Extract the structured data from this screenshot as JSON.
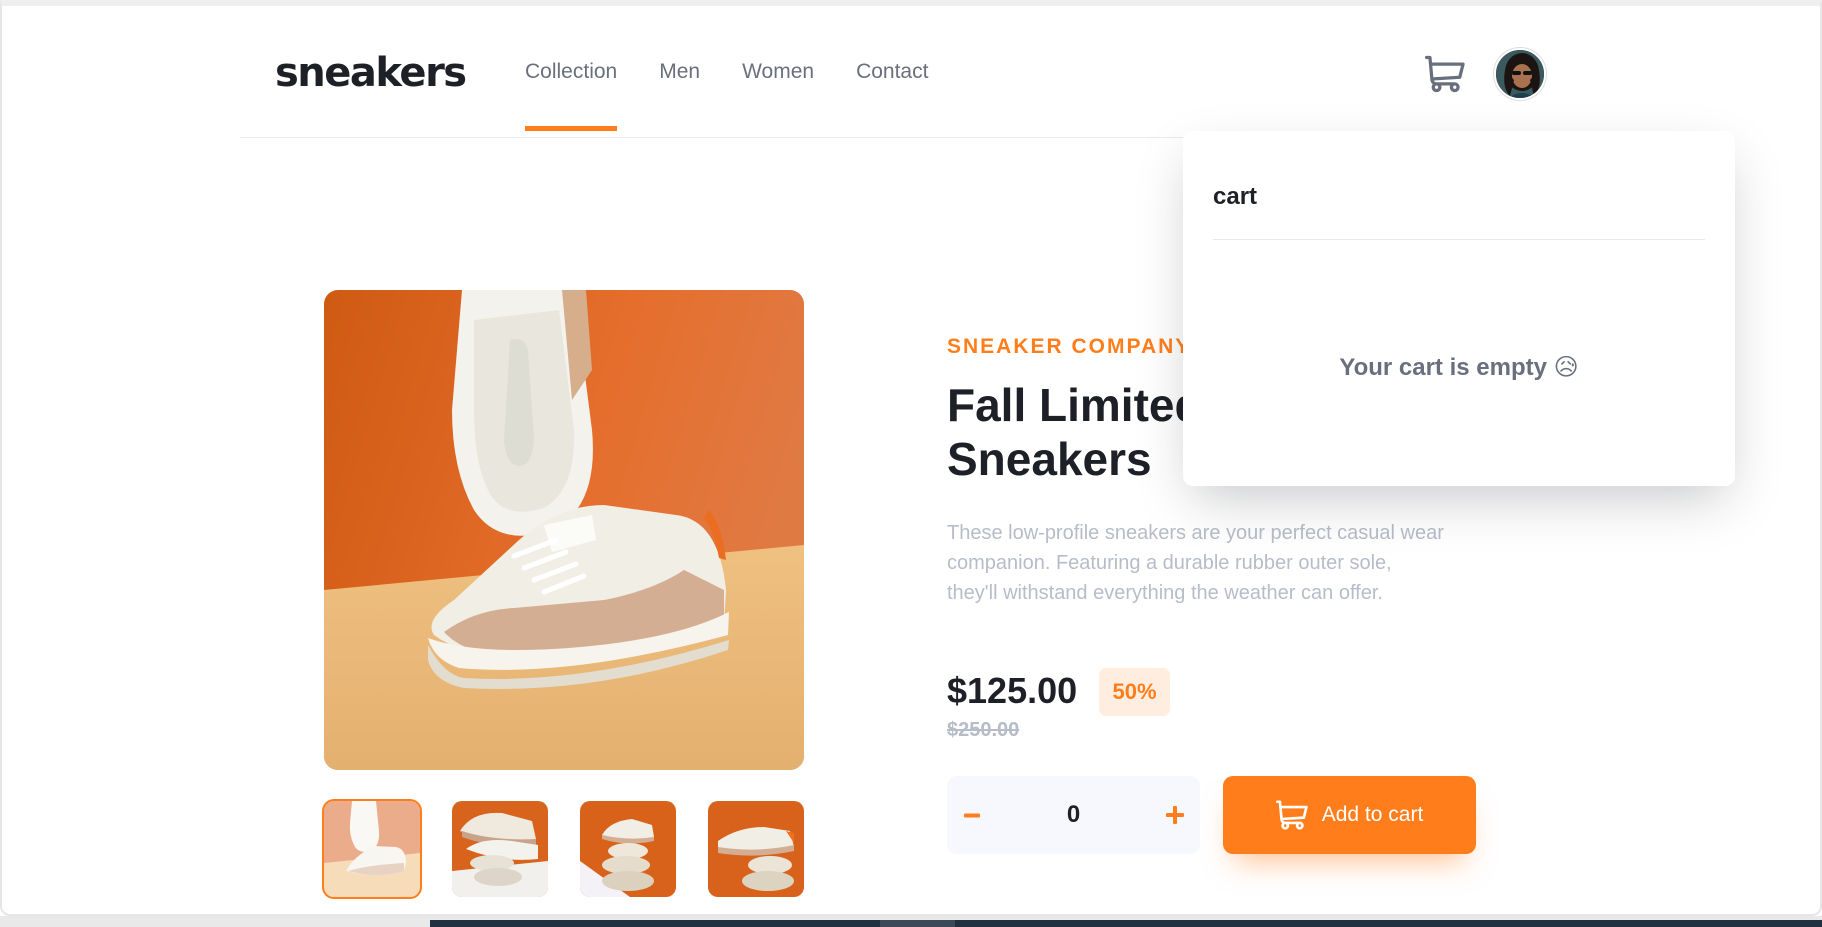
{
  "brand": {
    "logo": "sneakers"
  },
  "nav": {
    "items": [
      {
        "label": "Collection",
        "active": true
      },
      {
        "label": "Men",
        "active": false
      },
      {
        "label": "Women",
        "active": false
      },
      {
        "label": "Contact",
        "active": false
      }
    ]
  },
  "cart": {
    "title": "cart",
    "empty_message": "Your cart is empty 😥"
  },
  "product": {
    "company": "SNEAKER COMPANY",
    "title_line1": "Fall Limited Edition",
    "title_line2": "Sneakers",
    "description": "These low-profile sneakers are your perfect casual wear companion. Featuring a durable rubber outer sole, they'll withstand everything the weather can offer.",
    "price": "$125.00",
    "discount": "50%",
    "old_price": "$250.00"
  },
  "quantity": {
    "value": "0"
  },
  "actions": {
    "add_to_cart": "Add to cart"
  },
  "colors": {
    "accent": "#ff7e1b",
    "dark": "#1d2026",
    "muted": "#69707d",
    "light_muted": "#b6bcc8",
    "pale_orange": "#ffede0"
  },
  "icons": {
    "cart": "cart-icon",
    "minus": "minus-icon",
    "plus": "plus-icon"
  }
}
